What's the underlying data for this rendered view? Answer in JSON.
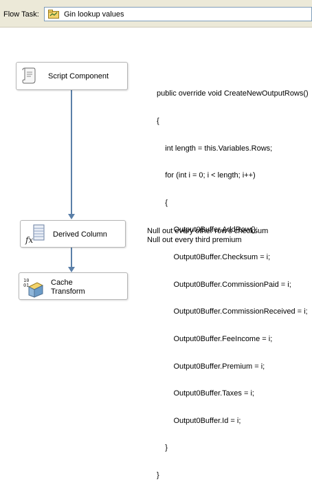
{
  "toolbar": {
    "flow_task_label": "Flow Task:",
    "selected_task": "Gin lookup values"
  },
  "tasks": [
    {
      "name": "Script Component",
      "icon": "script-icon"
    },
    {
      "name": "Derived Column",
      "icon": "derived-column-fx-icon"
    },
    {
      "name": "Cache Transform",
      "icon": "cache-transform-icon"
    }
  ],
  "code_lines": [
    "public override void CreateNewOutputRows()",
    "{",
    "    int length = this.Variables.Rows;",
    "    for (int i = 0; i < length; i++)",
    "    {",
    "        Output0Buffer.AddRow();",
    "        Output0Buffer.Checksum = i;",
    "        Output0Buffer.CommissionPaid = i;",
    "        Output0Buffer.CommissionReceived = i;",
    "        Output0Buffer.FeeIncome = i;",
    "        Output0Buffer.Premium = i;",
    "        Output0Buffer.Taxes = i;",
    "        Output0Buffer.Id = i;",
    "    }",
    "}"
  ],
  "derived_notes": [
    "Null out every other row's checksum",
    "Null out every third premium"
  ],
  "colors": {
    "connector": "#5a7fa8",
    "toolbar_bg": "#ece9d8"
  }
}
